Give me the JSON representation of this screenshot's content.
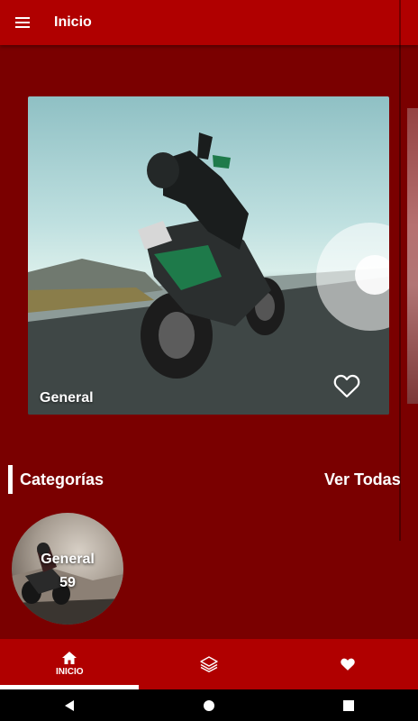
{
  "appbar": {
    "title": "Inicio",
    "menu_icon": "menu-icon"
  },
  "hero": {
    "label": "General",
    "favorite_icon": "heart-outline-icon"
  },
  "categories": {
    "title": "Categorías",
    "see_all": "Ver Todas",
    "items": [
      {
        "name": "General",
        "count": "59"
      }
    ]
  },
  "bottom_nav": {
    "items": [
      {
        "label": "INICIO",
        "icon": "home-icon",
        "active": true
      },
      {
        "label": "",
        "icon": "layers-icon",
        "active": false
      },
      {
        "label": "",
        "icon": "heart-icon",
        "active": false
      }
    ]
  },
  "system_nav": {
    "icons": [
      "back-icon",
      "home-circle-icon",
      "recents-icon"
    ]
  },
  "colors": {
    "appbar": "#b00000",
    "background": "#7a0000",
    "text": "#ffffff"
  }
}
